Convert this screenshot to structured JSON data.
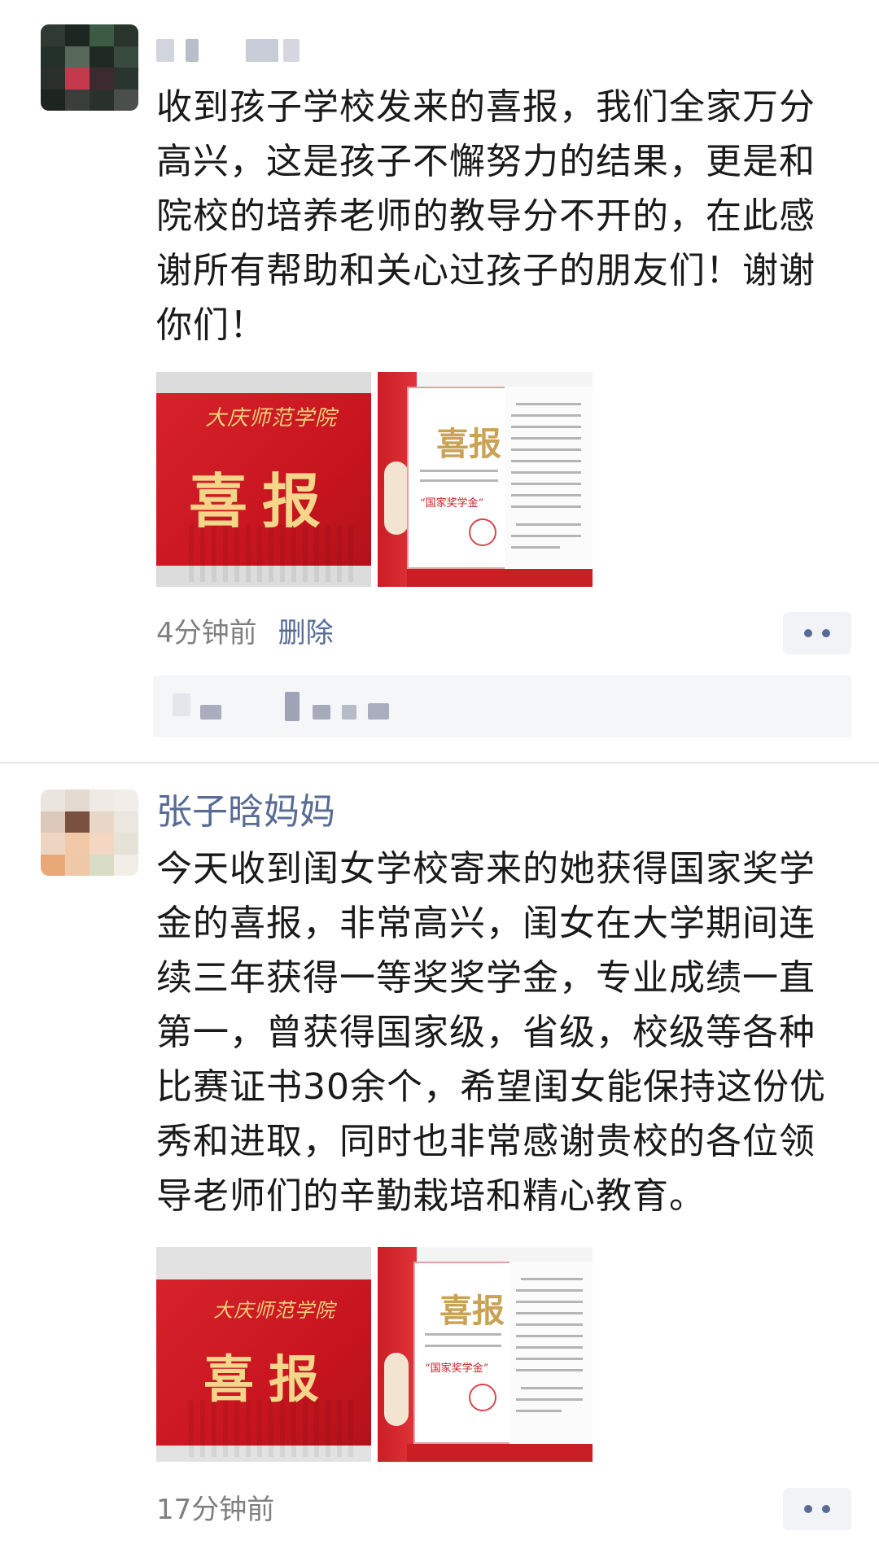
{
  "post1": {
    "text": "收到孩子学校发来的喜报，我们全家万分高兴，这是孩子不懈努力的结果，更是和院校的培养老师的教导分不开的，在此感谢所有帮助和关心过孩子的朋友们！谢谢你们！",
    "timestamp": "4分钟前",
    "delete_label": "删除",
    "photos": [
      {
        "school": "大庆师范学院",
        "title": "喜报"
      },
      {
        "title": "喜报",
        "award": "“国家奖学金”"
      }
    ]
  },
  "post2": {
    "nickname": "张子晗妈妈",
    "text": "今天收到闺女学校寄来的她获得国家奖学金的喜报，非常高兴，闺女在大学期间连续三年获得一等奖奖学金，专业成绩一直第一，曾获得国家级，省级，校级等各种比赛证书30余个，希望闺女能保持这份优秀和进取，同时也非常感谢贵校的各位领导老师们的辛勤栽培和精心教育。",
    "timestamp": "17分钟前",
    "photos": [
      {
        "school": "大庆师范学院",
        "title": "喜报"
      },
      {
        "title": "喜报",
        "award": "“国家奖学金”"
      }
    ]
  },
  "colors": {
    "link": "#576b95",
    "meta_gray": "#7f7f7f",
    "envelope_red": "#d7222b",
    "gold": "#f3d68a"
  },
  "icons": {
    "more": "more-dots-icon"
  }
}
